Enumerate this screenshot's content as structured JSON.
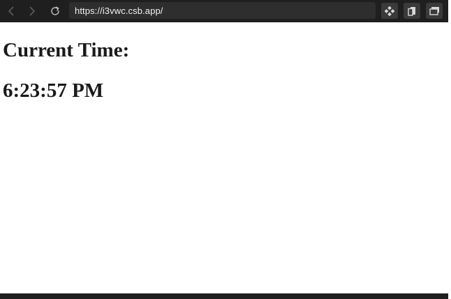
{
  "browser": {
    "url": "https://i3vwc.csb.app/",
    "nav_icons": [
      "back-arrow-icon",
      "forward-arrow-icon",
      "reload-icon"
    ],
    "toolbar_icons": [
      "move-icon",
      "copy-icon",
      "open-window-icon"
    ]
  },
  "page": {
    "label": "Current Time:",
    "time": "6:23:57 PM"
  },
  "colors": {
    "toolbar_bg": "#1f1f1f",
    "address_bg": "#2e2e2e",
    "page_bg": "#ffffff",
    "text": "#1a1a1a"
  }
}
